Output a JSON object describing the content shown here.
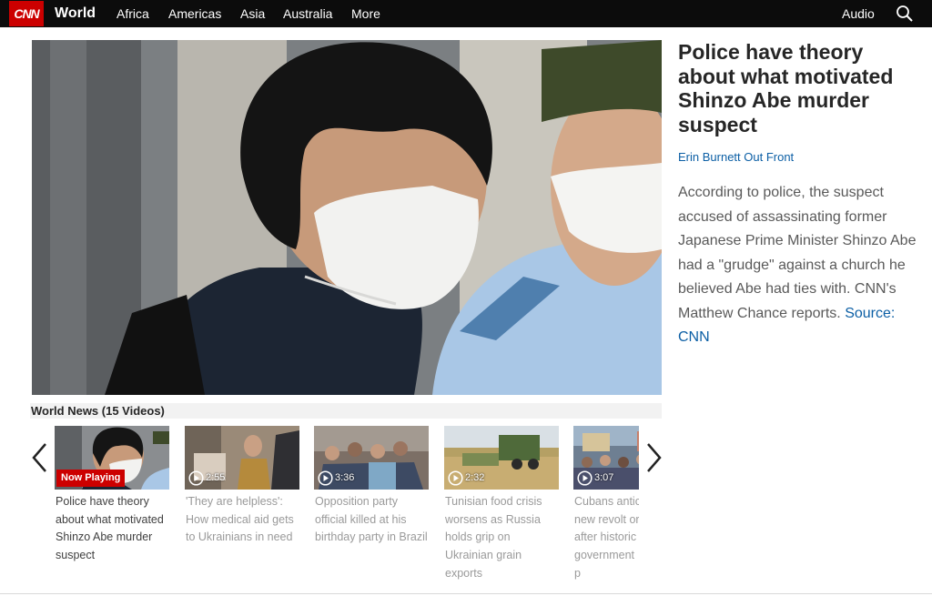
{
  "nav": {
    "logo": "CNN",
    "section": "World",
    "links": [
      "Africa",
      "Americas",
      "Asia",
      "Australia",
      "More"
    ],
    "audio": "Audio",
    "search_icon": "search-icon"
  },
  "video": {
    "headline": "Police have theory about what motivated Shinzo Abe murder suspect",
    "byline": "Erin Burnett Out Front",
    "description": "According to police, the suspect accused of assassinating former Japanese Prime Minister Shinzo Abe had a \"grudge\" against a church he believed Abe had ties with. CNN's Matthew Chance reports.",
    "source_label": "Source: CNN"
  },
  "playlist": {
    "title": "World News (15 Videos)",
    "items": [
      {
        "title": "Police have theory about what motivated Shinzo Abe murder suspect",
        "badge": "Now Playing",
        "duration": ""
      },
      {
        "title": "'They are helpless': How medical aid gets to Ukrainians in need",
        "badge": "",
        "duration": "2:55"
      },
      {
        "title": "Opposition party official killed at his birthday party in Brazil",
        "badge": "",
        "duration": "3:36"
      },
      {
        "title": "Tunisian food crisis worsens as Russia holds grip on Ukrainian grain exports",
        "badge": "",
        "duration": "2:32"
      },
      {
        "title": "Cubans antic new revolt or after historic government p",
        "badge": "",
        "duration": "3:07"
      }
    ]
  },
  "colors": {
    "brand_red": "#cc0000",
    "link_blue": "#0c5fa5",
    "nav_bg": "#0c0c0c"
  }
}
